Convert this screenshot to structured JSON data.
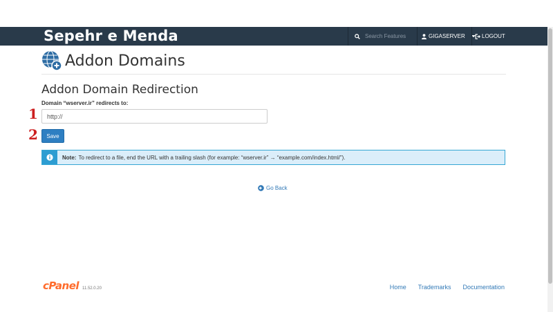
{
  "app": {
    "brand_title": "Sepehr e Menda",
    "page_title": "Addon Domains",
    "page_icon": "addon-domains-globe-plus-icon"
  },
  "navbar": {
    "search_placeholder": "Search Features",
    "search_icon": "search-icon",
    "user_label": "GIGASERVER",
    "user_icon": "user-icon",
    "logout_label": "LOGOUT",
    "logout_icon": "logout-icon",
    "bg_color": "#293a4a"
  },
  "form": {
    "section_title": "Addon Domain Redirection",
    "field_label": "Domain “wserver.ir” redirects to:",
    "url_value": "http://",
    "save_label": "Save",
    "save_color": "#2e7fc2"
  },
  "annotations": {
    "step1": "1",
    "step2": "2",
    "color": "#cc1f1f"
  },
  "note": {
    "label": "Note:",
    "text": "To redirect to a file, end the URL with a trailing slash (for example: “wserver.ir” → “example.com/index.html/”).",
    "icon": "info-icon",
    "bg_color": "#dbeefa",
    "border_color": "#34a6d4"
  },
  "nav": {
    "go_back_label": "Go Back",
    "go_back_icon": "arrow-circle-left-icon"
  },
  "footer": {
    "logo_text": "cPanel",
    "version": "11.52.0.20",
    "links": [
      "Home",
      "Trademarks",
      "Documentation"
    ],
    "logo_color": "#ff6c2c"
  }
}
